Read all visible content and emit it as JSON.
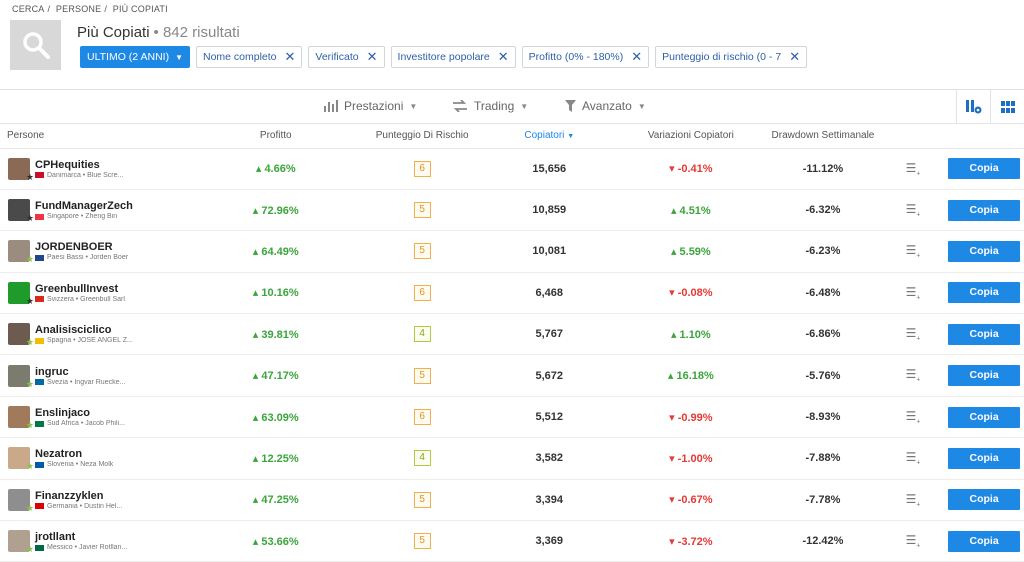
{
  "breadcrumb": [
    "CERCA",
    "/",
    "PERSONE",
    "/",
    "PIÙ COPIATI"
  ],
  "header": {
    "title": "Più Copiati",
    "count": "• 842 risultati"
  },
  "filters": {
    "period": "ULTIMO (2 ANNI)",
    "chips": [
      "Nome completo",
      "Verificato",
      "Investitore popolare",
      "Profitto (0% - 180%)",
      "Punteggio di rischio (0 - 7"
    ]
  },
  "toolbar": {
    "stats": "Prestazioni",
    "trading": "Trading",
    "advanced": "Avanzato"
  },
  "columns": {
    "person": "Persone",
    "profit": "Profitto",
    "risk": "Punteggio Di Rischio",
    "copiers": "Copiatori",
    "copier_change": "Variazioni Copiatori",
    "drawdown": "Drawdown Settimanale"
  },
  "copy_label": "Copia",
  "rows": [
    {
      "name": "CPHequities",
      "sub": "Danimarca • Blue Scre...",
      "profit": "4.66%",
      "risk": "6",
      "copiers": "15,656",
      "change": "-0.41%",
      "change_dir": "neg",
      "drawdown": "-11.12%",
      "avatar": "#8a6a55",
      "flag": "#c8102e",
      "star": "dark"
    },
    {
      "name": "FundManagerZech",
      "sub": "Singapore • Zheng Bin",
      "profit": "72.96%",
      "risk": "5",
      "copiers": "10,859",
      "change": "4.51%",
      "change_dir": "pos",
      "drawdown": "-6.32%",
      "avatar": "#4a4a4a",
      "flag": "#ef3340",
      "star": "dark"
    },
    {
      "name": "JORDENBOER",
      "sub": "Paesi Bassi • Jorden Boer",
      "profit": "64.49%",
      "risk": "5",
      "copiers": "10,081",
      "change": "5.59%",
      "change_dir": "pos",
      "drawdown": "-6.23%",
      "avatar": "#9b8c80",
      "flag": "#21468b",
      "star": "green"
    },
    {
      "name": "GreenbullInvest",
      "sub": "Svizzera • Greenbull Sarl",
      "profit": "10.16%",
      "risk": "6",
      "copiers": "6,468",
      "change": "-0.08%",
      "change_dir": "neg",
      "drawdown": "-6.48%",
      "avatar": "#1f9b2c",
      "flag": "#da291c",
      "star": "dark"
    },
    {
      "name": "Analisisciclico",
      "sub": "Spagna • JOSE ANGEL Z...",
      "profit": "39.81%",
      "risk": "4",
      "copiers": "5,767",
      "change": "1.10%",
      "change_dir": "pos",
      "drawdown": "-6.86%",
      "avatar": "#6d5b4f",
      "flag": "#f1bf00",
      "star": "green"
    },
    {
      "name": "ingruc",
      "sub": "Svezia • Ingvar Ruecke...",
      "profit": "47.17%",
      "risk": "5",
      "copiers": "5,672",
      "change": "16.18%",
      "change_dir": "pos",
      "drawdown": "-5.76%",
      "avatar": "#7b7b6e",
      "flag": "#006aa7",
      "star": "green"
    },
    {
      "name": "Enslinjaco",
      "sub": "Sud Africa • Jacob Phili...",
      "profit": "63.09%",
      "risk": "6",
      "copiers": "5,512",
      "change": "-0.99%",
      "change_dir": "neg",
      "drawdown": "-8.93%",
      "avatar": "#a07a5a",
      "flag": "#007749",
      "star": "green"
    },
    {
      "name": "Nezatron",
      "sub": "Slovenia • Neza Molk",
      "profit": "12.25%",
      "risk": "4",
      "copiers": "3,582",
      "change": "-1.00%",
      "change_dir": "neg",
      "drawdown": "-7.88%",
      "avatar": "#c9a98a",
      "flag": "#005da4",
      "star": "green"
    },
    {
      "name": "Finanzzyklen",
      "sub": "Germania • Dustin Hel...",
      "profit": "47.25%",
      "risk": "5",
      "copiers": "3,394",
      "change": "-0.67%",
      "change_dir": "neg",
      "drawdown": "-7.78%",
      "avatar": "#8e8e8e",
      "flag": "#dd0000",
      "star": "green"
    },
    {
      "name": "jrotllant",
      "sub": "Messico • Javier Rotllan...",
      "profit": "53.66%",
      "risk": "5",
      "copiers": "3,369",
      "change": "-3.72%",
      "change_dir": "neg",
      "drawdown": "-12.42%",
      "avatar": "#b0a090",
      "flag": "#006847",
      "star": "green"
    }
  ]
}
